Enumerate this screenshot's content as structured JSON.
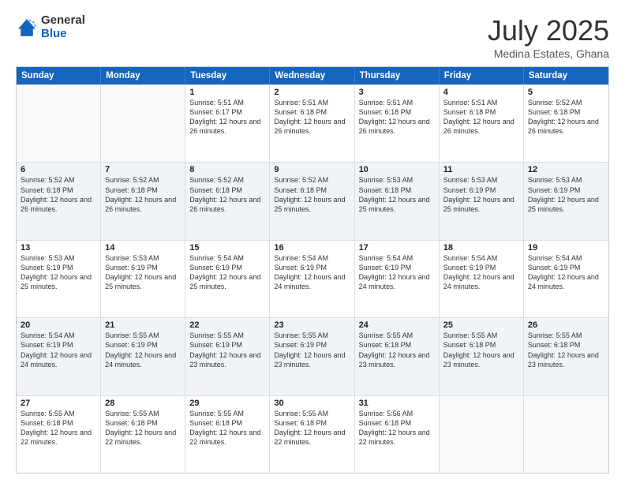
{
  "logo": {
    "general": "General",
    "blue": "Blue"
  },
  "header": {
    "month": "July 2025",
    "location": "Medina Estates, Ghana"
  },
  "weekdays": [
    "Sunday",
    "Monday",
    "Tuesday",
    "Wednesday",
    "Thursday",
    "Friday",
    "Saturday"
  ],
  "rows": [
    [
      {
        "day": "",
        "sunrise": "",
        "sunset": "",
        "daylight": "",
        "empty": true
      },
      {
        "day": "",
        "sunrise": "",
        "sunset": "",
        "daylight": "",
        "empty": true
      },
      {
        "day": "1",
        "sunrise": "Sunrise: 5:51 AM",
        "sunset": "Sunset: 6:17 PM",
        "daylight": "Daylight: 12 hours and 26 minutes."
      },
      {
        "day": "2",
        "sunrise": "Sunrise: 5:51 AM",
        "sunset": "Sunset: 6:18 PM",
        "daylight": "Daylight: 12 hours and 26 minutes."
      },
      {
        "day": "3",
        "sunrise": "Sunrise: 5:51 AM",
        "sunset": "Sunset: 6:18 PM",
        "daylight": "Daylight: 12 hours and 26 minutes."
      },
      {
        "day": "4",
        "sunrise": "Sunrise: 5:51 AM",
        "sunset": "Sunset: 6:18 PM",
        "daylight": "Daylight: 12 hours and 26 minutes."
      },
      {
        "day": "5",
        "sunrise": "Sunrise: 5:52 AM",
        "sunset": "Sunset: 6:18 PM",
        "daylight": "Daylight: 12 hours and 26 minutes."
      }
    ],
    [
      {
        "day": "6",
        "sunrise": "Sunrise: 5:52 AM",
        "sunset": "Sunset: 6:18 PM",
        "daylight": "Daylight: 12 hours and 26 minutes."
      },
      {
        "day": "7",
        "sunrise": "Sunrise: 5:52 AM",
        "sunset": "Sunset: 6:18 PM",
        "daylight": "Daylight: 12 hours and 26 minutes."
      },
      {
        "day": "8",
        "sunrise": "Sunrise: 5:52 AM",
        "sunset": "Sunset: 6:18 PM",
        "daylight": "Daylight: 12 hours and 26 minutes."
      },
      {
        "day": "9",
        "sunrise": "Sunrise: 5:52 AM",
        "sunset": "Sunset: 6:18 PM",
        "daylight": "Daylight: 12 hours and 25 minutes."
      },
      {
        "day": "10",
        "sunrise": "Sunrise: 5:53 AM",
        "sunset": "Sunset: 6:18 PM",
        "daylight": "Daylight: 12 hours and 25 minutes."
      },
      {
        "day": "11",
        "sunrise": "Sunrise: 5:53 AM",
        "sunset": "Sunset: 6:19 PM",
        "daylight": "Daylight: 12 hours and 25 minutes."
      },
      {
        "day": "12",
        "sunrise": "Sunrise: 5:53 AM",
        "sunset": "Sunset: 6:19 PM",
        "daylight": "Daylight: 12 hours and 25 minutes."
      }
    ],
    [
      {
        "day": "13",
        "sunrise": "Sunrise: 5:53 AM",
        "sunset": "Sunset: 6:19 PM",
        "daylight": "Daylight: 12 hours and 25 minutes."
      },
      {
        "day": "14",
        "sunrise": "Sunrise: 5:53 AM",
        "sunset": "Sunset: 6:19 PM",
        "daylight": "Daylight: 12 hours and 25 minutes."
      },
      {
        "day": "15",
        "sunrise": "Sunrise: 5:54 AM",
        "sunset": "Sunset: 6:19 PM",
        "daylight": "Daylight: 12 hours and 25 minutes."
      },
      {
        "day": "16",
        "sunrise": "Sunrise: 5:54 AM",
        "sunset": "Sunset: 6:19 PM",
        "daylight": "Daylight: 12 hours and 24 minutes."
      },
      {
        "day": "17",
        "sunrise": "Sunrise: 5:54 AM",
        "sunset": "Sunset: 6:19 PM",
        "daylight": "Daylight: 12 hours and 24 minutes."
      },
      {
        "day": "18",
        "sunrise": "Sunrise: 5:54 AM",
        "sunset": "Sunset: 6:19 PM",
        "daylight": "Daylight: 12 hours and 24 minutes."
      },
      {
        "day": "19",
        "sunrise": "Sunrise: 5:54 AM",
        "sunset": "Sunset: 6:19 PM",
        "daylight": "Daylight: 12 hours and 24 minutes."
      }
    ],
    [
      {
        "day": "20",
        "sunrise": "Sunrise: 5:54 AM",
        "sunset": "Sunset: 6:19 PM",
        "daylight": "Daylight: 12 hours and 24 minutes."
      },
      {
        "day": "21",
        "sunrise": "Sunrise: 5:55 AM",
        "sunset": "Sunset: 6:19 PM",
        "daylight": "Daylight: 12 hours and 24 minutes."
      },
      {
        "day": "22",
        "sunrise": "Sunrise: 5:55 AM",
        "sunset": "Sunset: 6:19 PM",
        "daylight": "Daylight: 12 hours and 23 minutes."
      },
      {
        "day": "23",
        "sunrise": "Sunrise: 5:55 AM",
        "sunset": "Sunset: 6:19 PM",
        "daylight": "Daylight: 12 hours and 23 minutes."
      },
      {
        "day": "24",
        "sunrise": "Sunrise: 5:55 AM",
        "sunset": "Sunset: 6:18 PM",
        "daylight": "Daylight: 12 hours and 23 minutes."
      },
      {
        "day": "25",
        "sunrise": "Sunrise: 5:55 AM",
        "sunset": "Sunset: 6:18 PM",
        "daylight": "Daylight: 12 hours and 23 minutes."
      },
      {
        "day": "26",
        "sunrise": "Sunrise: 5:55 AM",
        "sunset": "Sunset: 6:18 PM",
        "daylight": "Daylight: 12 hours and 23 minutes."
      }
    ],
    [
      {
        "day": "27",
        "sunrise": "Sunrise: 5:55 AM",
        "sunset": "Sunset: 6:18 PM",
        "daylight": "Daylight: 12 hours and 22 minutes."
      },
      {
        "day": "28",
        "sunrise": "Sunrise: 5:55 AM",
        "sunset": "Sunset: 6:18 PM",
        "daylight": "Daylight: 12 hours and 22 minutes."
      },
      {
        "day": "29",
        "sunrise": "Sunrise: 5:55 AM",
        "sunset": "Sunset: 6:18 PM",
        "daylight": "Daylight: 12 hours and 22 minutes."
      },
      {
        "day": "30",
        "sunrise": "Sunrise: 5:55 AM",
        "sunset": "Sunset: 6:18 PM",
        "daylight": "Daylight: 12 hours and 22 minutes."
      },
      {
        "day": "31",
        "sunrise": "Sunrise: 5:56 AM",
        "sunset": "Sunset: 6:18 PM",
        "daylight": "Daylight: 12 hours and 22 minutes."
      },
      {
        "day": "",
        "sunrise": "",
        "sunset": "",
        "daylight": "",
        "empty": true
      },
      {
        "day": "",
        "sunrise": "",
        "sunset": "",
        "daylight": "",
        "empty": true
      }
    ]
  ]
}
